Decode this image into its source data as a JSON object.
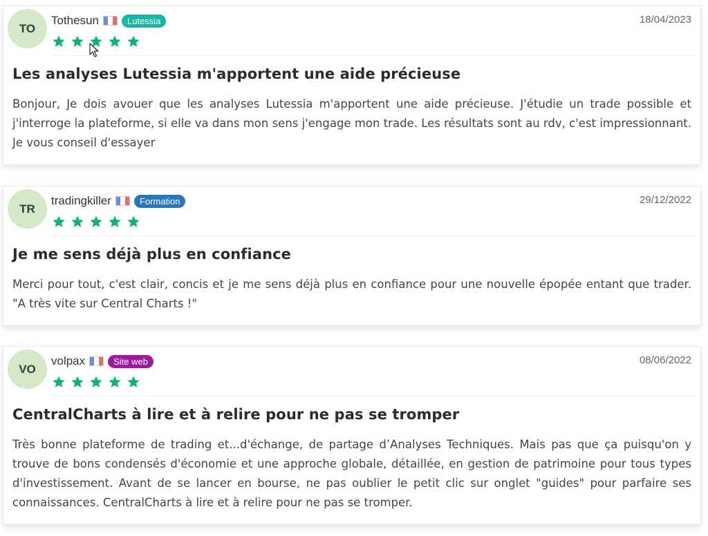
{
  "reviews": [
    {
      "initials": "TO",
      "username": "Tothesun",
      "badge": "Lutessia",
      "badge_color": "#14b8a6",
      "date": "18/04/2023",
      "rating": 5,
      "title": "Les analyses Lutessia m'apportent une aide précieuse",
      "body": "Bonjour, Je dois avouer que les analyses Lutessia m'apportent une aide précieuse. J'étudie un trade possible et j'interroge la plateforme, si elle va dans mon sens j'engage mon trade. Les résultats sont au rdv, c'est impressionnant. Je vous conseil d'essayer"
    },
    {
      "initials": "TR",
      "username": "tradingkiller",
      "badge": "Formation",
      "badge_color": "#2f74b5",
      "date": "29/12/2022",
      "rating": 5,
      "title": "Je me sens déjà plus en confiance",
      "body": "Merci pour tout, c'est clair, concis et je me sens déjà plus en confiance pour une nouvelle épopée entant que trader. \"A très vite sur Central Charts !\""
    },
    {
      "initials": "VO",
      "username": "volpax",
      "badge": "Site web",
      "badge_color": "#9c1a9c",
      "date": "08/06/2022",
      "rating": 5,
      "title": "CentralCharts à lire et à relire pour ne pas se tromper",
      "body": "Très bonne plateforme de trading et...d'échange, de partage d’Analyses Techniques. Mais pas que ça puisqu'on y trouve de bons condensés d'économie et une approche globale, détaillée, en gestion de patrimoine pour tous types d'investissement. Avant de se lancer en bourse, ne pas oublier le petit clic sur onglet \"guides\" pour parfaire ses connaissances. CentralCharts à lire et à relire pour ne pas se tromper."
    }
  ],
  "colors": {
    "star": "#10b27c",
    "avatar_bg": "#d4e8c8"
  },
  "icons": {
    "star": "star-icon",
    "flag": "france-flag-icon",
    "cursor": "mouse-pointer-icon"
  }
}
